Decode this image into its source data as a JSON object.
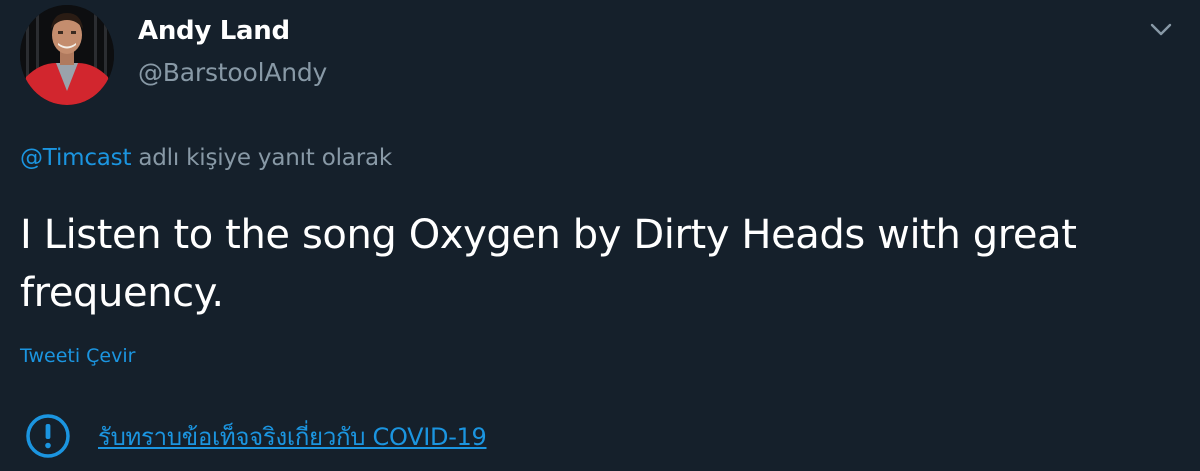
{
  "tweet": {
    "display_name": "Andy Land",
    "handle": "@BarstoolAndy",
    "reply_to_handle": "@Timcast",
    "reply_suffix": " adlı kişiye yanıt olarak",
    "text": "I Listen to the song Oxygen by Dirty Heads with great frequency.",
    "translate_label": "Tweeti Çevir",
    "covid_notice": "รับทราบข้อเท็จจริงเกี่ยวกับ COVID-19"
  },
  "icons": {
    "menu": "chevron-down-icon",
    "notice": "exclamation-circle-icon"
  },
  "colors": {
    "background": "#15202b",
    "primary_text": "#ffffff",
    "secondary_text": "#8899a6",
    "link": "#1b95e0"
  }
}
